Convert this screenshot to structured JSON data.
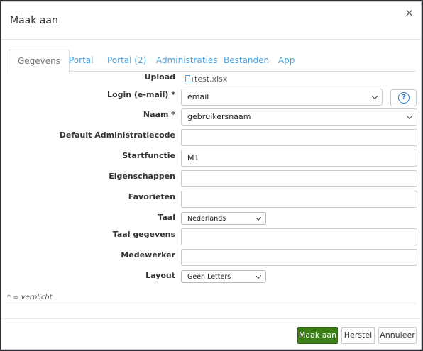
{
  "dialog": {
    "title": "Maak aan",
    "close": "×"
  },
  "tabs": [
    {
      "label": "Gegevens",
      "active": true
    },
    {
      "label": "Portal",
      "active": false
    },
    {
      "label": "Portal (2)",
      "active": false
    },
    {
      "label": "Administraties",
      "active": false
    },
    {
      "label": "Bestanden",
      "active": false
    },
    {
      "label": "App",
      "active": false
    }
  ],
  "form": {
    "upload": {
      "label": "Upload",
      "file": "test.xlsx"
    },
    "login": {
      "label": "Login (e-mail) *",
      "value": "email"
    },
    "naam": {
      "label": "Naam *",
      "value": "gebruikersnaam"
    },
    "default_admin": {
      "label": "Default Administratiecode",
      "value": ""
    },
    "startfunctie": {
      "label": "Startfunctie",
      "value": "M1"
    },
    "eigenschappen": {
      "label": "Eigenschappen",
      "value": ""
    },
    "favorieten": {
      "label": "Favorieten",
      "value": ""
    },
    "taal": {
      "label": "Taal",
      "value": "Nederlands"
    },
    "taal_gegevens": {
      "label": "Taal gegevens",
      "value": ""
    },
    "medewerker": {
      "label": "Medewerker",
      "value": ""
    },
    "layout": {
      "label": "Layout",
      "value": "Geen Letters"
    },
    "help": "?"
  },
  "required_note": "* = verplicht",
  "buttons": {
    "create": "Maak aan",
    "reset": "Herstel",
    "cancel": "Annuleer"
  },
  "colors": {
    "primary_button": "#3b7d16",
    "tab_link": "#4aa3df",
    "help_icon": "#2d7fcf"
  }
}
